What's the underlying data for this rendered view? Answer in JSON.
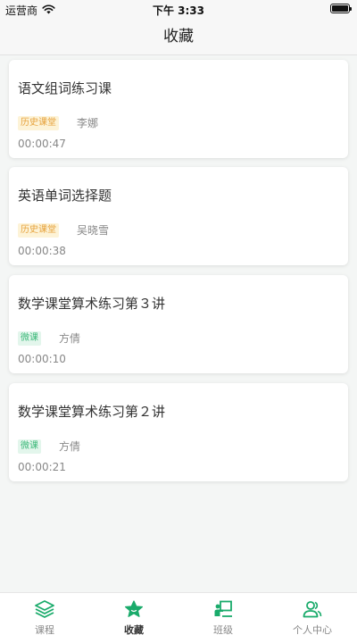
{
  "status": {
    "carrier": "运营商",
    "time": "下午 3:33"
  },
  "header": {
    "title": "收藏"
  },
  "favorites": [
    {
      "title": "语文组词练习课",
      "tag": "历史课堂",
      "tag_type": "history",
      "teacher": "李娜",
      "duration": "00:00:47"
    },
    {
      "title": "英语单词选择题",
      "tag": "历史课堂",
      "tag_type": "history",
      "teacher": "吴晓雪",
      "duration": "00:00:38"
    },
    {
      "title": "数学课堂算术练习第３讲",
      "tag": "微课",
      "tag_type": "micro",
      "teacher": "方倩",
      "duration": "00:00:10"
    },
    {
      "title": "数学课堂算术练习第２讲",
      "tag": "微课",
      "tag_type": "micro",
      "teacher": "方倩",
      "duration": "00:00:21"
    }
  ],
  "tabbar": {
    "items": [
      {
        "label": "课程",
        "icon": "layers-icon",
        "active": false
      },
      {
        "label": "收藏",
        "icon": "star-icon",
        "active": true
      },
      {
        "label": "班级",
        "icon": "classroom-icon",
        "active": false
      },
      {
        "label": "个人中心",
        "icon": "users-icon",
        "active": false
      }
    ]
  },
  "colors": {
    "accent": "#1aab6b",
    "history_tag_bg": "#fdf3d7",
    "history_tag_text": "#e6a23c",
    "micro_tag_bg": "#e3f6ec",
    "micro_tag_text": "#3cb879"
  }
}
